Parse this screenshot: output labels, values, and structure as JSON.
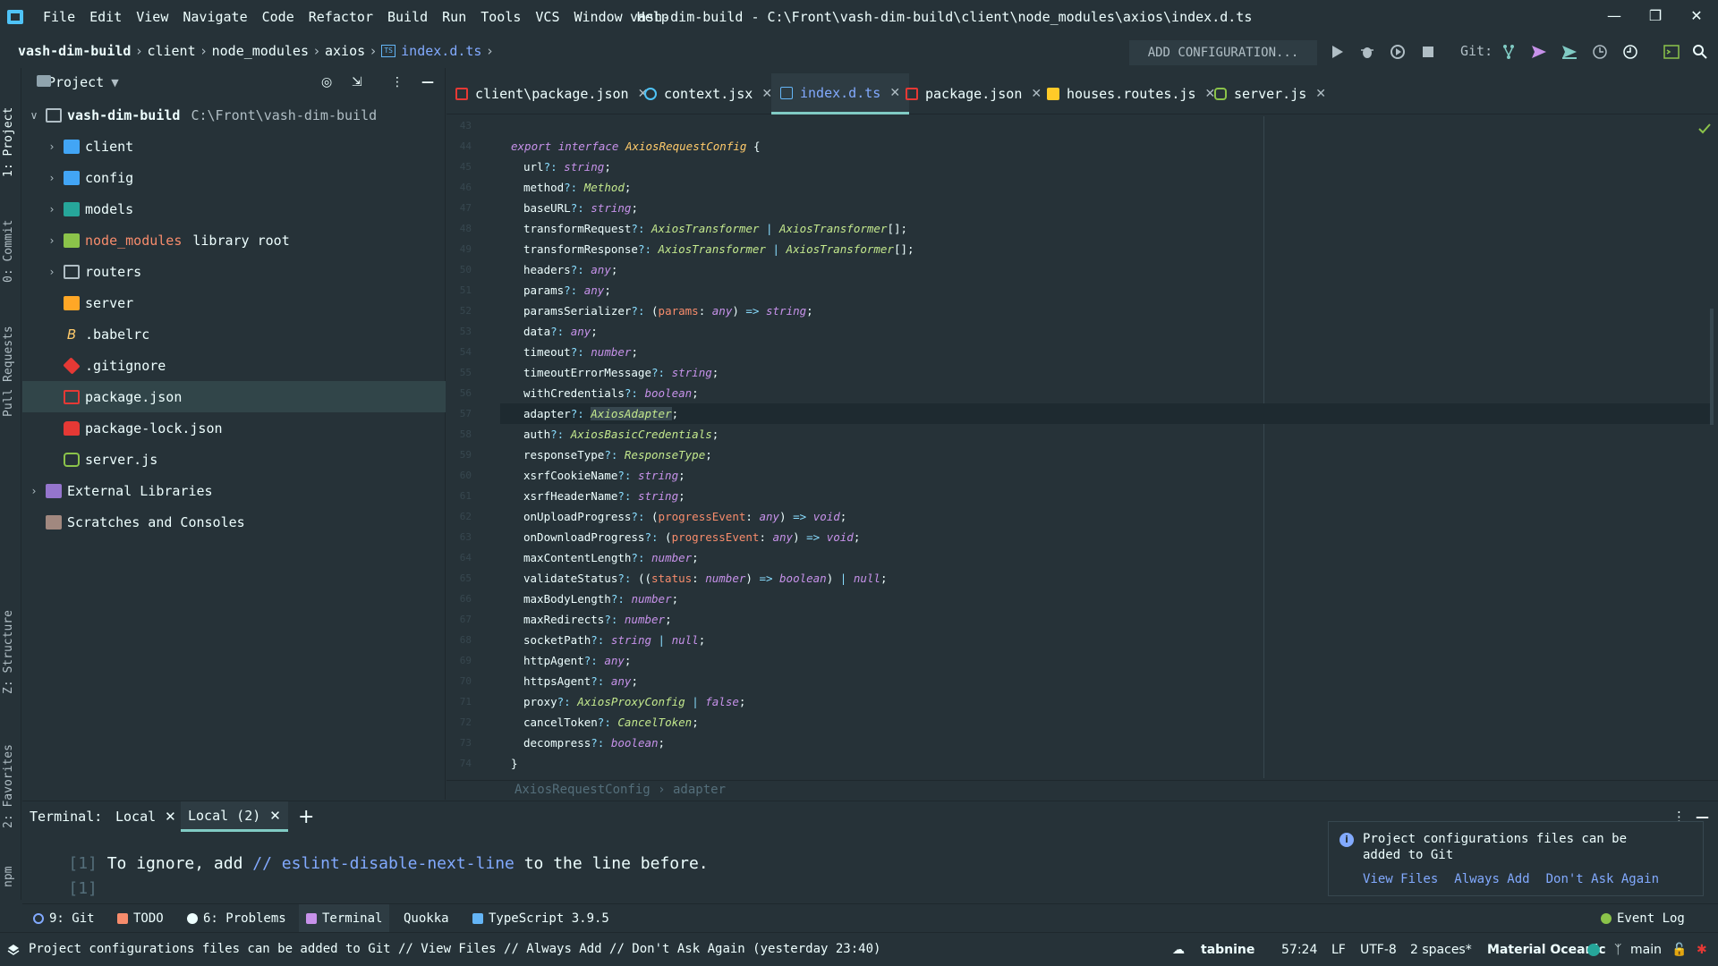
{
  "app": {
    "menu": [
      "File",
      "Edit",
      "View",
      "Navigate",
      "Code",
      "Refactor",
      "Build",
      "Run",
      "Tools",
      "VCS",
      "Window",
      "Help"
    ],
    "window_title": "vash-dim-build - C:\\Front\\vash-dim-build\\client\\node_modules\\axios\\index.d.ts"
  },
  "breadcrumb": [
    "vash-dim-build",
    "client",
    "node_modules",
    "axios",
    "index.d.ts"
  ],
  "toolbar": {
    "add_config": "ADD CONFIGURATION...",
    "git_label": "Git:"
  },
  "left_strip": [
    "1: Project",
    "0: Commit",
    "Pull Requests",
    "Z: Structure",
    "2: Favorites",
    "npm"
  ],
  "project": {
    "title": "Project",
    "tree": [
      {
        "label": "vash-dim-build",
        "hint": "C:\\Front\\vash-dim-build",
        "level": 0,
        "expanded": true,
        "icon": "folder-icon"
      },
      {
        "label": "client",
        "level": 1,
        "icon": "folder-blue-icon"
      },
      {
        "label": "config",
        "level": 1,
        "icon": "folder-config-icon"
      },
      {
        "label": "models",
        "level": 1,
        "icon": "folder-teal-icon"
      },
      {
        "label": "node_modules",
        "hint": "library root",
        "level": 1,
        "icon": "folder-node-icon"
      },
      {
        "label": "routers",
        "level": 1,
        "icon": "folder-outline-icon"
      },
      {
        "label": "server",
        "level": 1,
        "icon": "folder-server-icon"
      },
      {
        "label": ".babelrc",
        "level": 1,
        "icon": "babel-icon"
      },
      {
        "label": ".gitignore",
        "level": 1,
        "icon": "git-icon"
      },
      {
        "label": "package.json",
        "level": 1,
        "icon": "npm-icon",
        "selected": true
      },
      {
        "label": "package-lock.json",
        "level": 1,
        "icon": "lock-icon"
      },
      {
        "label": "server.js",
        "level": 1,
        "icon": "nodejs-icon"
      },
      {
        "label": "External Libraries",
        "level": 0,
        "icon": "library-icon"
      },
      {
        "label": "Scratches and Consoles",
        "level": 0,
        "icon": "scratches-icon"
      }
    ]
  },
  "editor_tabs": [
    {
      "label": "client\\package.json"
    },
    {
      "label": "context.jsx"
    },
    {
      "label": "index.d.ts",
      "active": true
    },
    {
      "label": "package.json"
    },
    {
      "label": "houses.routes.js"
    },
    {
      "label": "server.js"
    }
  ],
  "code": {
    "lines": [
      {
        "n": "43"
      },
      {
        "n": "44"
      },
      {
        "n": "45",
        "prop": "url",
        "t": "string"
      },
      {
        "n": "46",
        "prop": "method",
        "t": "Method"
      },
      {
        "n": "47",
        "prop": "baseURL",
        "t": "string"
      },
      {
        "n": "48",
        "prop": "transformRequest",
        "t": "AxiosTransformer | AxiosTransformer[]"
      },
      {
        "n": "49",
        "prop": "transformResponse",
        "t": "AxiosTransformer | AxiosTransformer[]"
      },
      {
        "n": "50",
        "prop": "headers",
        "t": "any"
      },
      {
        "n": "51",
        "prop": "params",
        "t": "any"
      },
      {
        "n": "52",
        "prop": "paramsSerializer",
        "t": "(params: any) => string"
      },
      {
        "n": "53",
        "prop": "data",
        "t": "any"
      },
      {
        "n": "54",
        "prop": "timeout",
        "t": "number"
      },
      {
        "n": "55",
        "prop": "timeoutErrorMessage",
        "t": "string"
      },
      {
        "n": "56",
        "prop": "withCredentials",
        "t": "boolean"
      },
      {
        "n": "57",
        "prop": "adapter",
        "t": "AxiosAdapter"
      },
      {
        "n": "58",
        "prop": "auth",
        "t": "AxiosBasicCredentials"
      },
      {
        "n": "59",
        "prop": "responseType",
        "t": "ResponseType"
      },
      {
        "n": "60",
        "prop": "xsrfCookieName",
        "t": "string"
      },
      {
        "n": "61",
        "prop": "xsrfHeaderName",
        "t": "string"
      },
      {
        "n": "62",
        "prop": "onUploadProgress",
        "t": "(progressEvent: any) => void"
      },
      {
        "n": "63",
        "prop": "onDownloadProgress",
        "t": "(progressEvent: any) => void"
      },
      {
        "n": "64",
        "prop": "maxContentLength",
        "t": "number"
      },
      {
        "n": "65",
        "prop": "validateStatus",
        "t": "((status: number) => boolean) | null"
      },
      {
        "n": "66",
        "prop": "maxBodyLength",
        "t": "number"
      },
      {
        "n": "67",
        "prop": "maxRedirects",
        "t": "number"
      },
      {
        "n": "68",
        "prop": "socketPath",
        "t": "string | null"
      },
      {
        "n": "69",
        "prop": "httpAgent",
        "t": "any"
      },
      {
        "n": "70",
        "prop": "httpsAgent",
        "t": "any"
      },
      {
        "n": "71",
        "prop": "proxy",
        "t": "AxiosProxyConfig | false"
      },
      {
        "n": "72",
        "prop": "cancelToken",
        "t": "CancelToken"
      },
      {
        "n": "73",
        "prop": "decompress",
        "t": "boolean"
      },
      {
        "n": "74"
      }
    ],
    "interface_line": {
      "export": "export",
      "interface": "interface",
      "name": "AxiosRequestConfig",
      "brace": "{"
    },
    "closing": "}",
    "current_line": "57",
    "editor_breadcrumb": "AxiosRequestConfig  ›  adapter"
  },
  "terminal": {
    "label": "Terminal:",
    "tabs": [
      "Local",
      "Local (2)"
    ],
    "lines": [
      {
        "idx": "[1]",
        "text_a": " To ignore, add ",
        "comment": "// eslint-disable-next-line",
        "text_b": " to the line before."
      },
      {
        "idx": "[1]"
      }
    ]
  },
  "notification": {
    "message": "Project configurations files can be added to Git",
    "actions": [
      "View Files",
      "Always Add",
      "Don't Ask Again"
    ]
  },
  "tool_windows": [
    "9: Git",
    "TODO",
    "6: Problems",
    "Terminal",
    "Quokka",
    "TypeScript 3.9.5"
  ],
  "event_log": "Event Log",
  "status_bar": {
    "message": "Project configurations files can be added to Git // View Files // Always Add // Don't Ask Again (yesterday 23:40)",
    "tabnine": "tabnine",
    "position": "57:24",
    "line_sep": "LF",
    "encoding": "UTF-8",
    "indent": "2 spaces*",
    "theme": "Material Oceanic",
    "branch": "main"
  },
  "colors": {
    "background": "#263238",
    "accent": "#80cbc4",
    "keyword": "#c792ea",
    "type": "#c3e88d",
    "link": "#82aaff"
  }
}
